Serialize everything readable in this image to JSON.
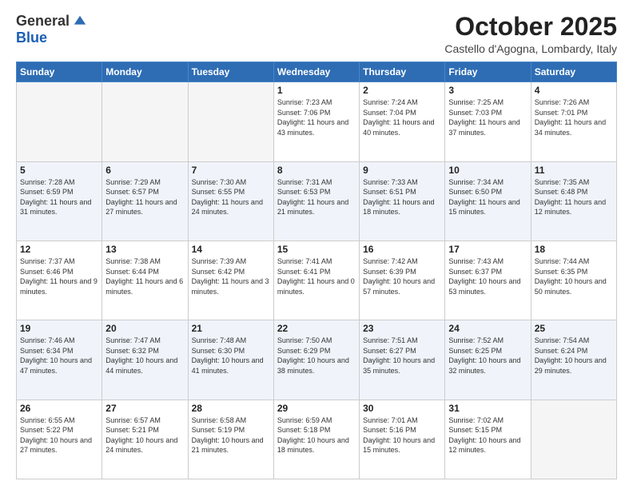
{
  "logo": {
    "general": "General",
    "blue": "Blue"
  },
  "header": {
    "month": "October 2025",
    "location": "Castello d'Agogna, Lombardy, Italy"
  },
  "days": [
    "Sunday",
    "Monday",
    "Tuesday",
    "Wednesday",
    "Thursday",
    "Friday",
    "Saturday"
  ],
  "weeks": [
    [
      {
        "day": "",
        "info": ""
      },
      {
        "day": "",
        "info": ""
      },
      {
        "day": "",
        "info": ""
      },
      {
        "day": "1",
        "info": "Sunrise: 7:23 AM\nSunset: 7:06 PM\nDaylight: 11 hours\nand 43 minutes."
      },
      {
        "day": "2",
        "info": "Sunrise: 7:24 AM\nSunset: 7:04 PM\nDaylight: 11 hours\nand 40 minutes."
      },
      {
        "day": "3",
        "info": "Sunrise: 7:25 AM\nSunset: 7:03 PM\nDaylight: 11 hours\nand 37 minutes."
      },
      {
        "day": "4",
        "info": "Sunrise: 7:26 AM\nSunset: 7:01 PM\nDaylight: 11 hours\nand 34 minutes."
      }
    ],
    [
      {
        "day": "5",
        "info": "Sunrise: 7:28 AM\nSunset: 6:59 PM\nDaylight: 11 hours\nand 31 minutes."
      },
      {
        "day": "6",
        "info": "Sunrise: 7:29 AM\nSunset: 6:57 PM\nDaylight: 11 hours\nand 27 minutes."
      },
      {
        "day": "7",
        "info": "Sunrise: 7:30 AM\nSunset: 6:55 PM\nDaylight: 11 hours\nand 24 minutes."
      },
      {
        "day": "8",
        "info": "Sunrise: 7:31 AM\nSunset: 6:53 PM\nDaylight: 11 hours\nand 21 minutes."
      },
      {
        "day": "9",
        "info": "Sunrise: 7:33 AM\nSunset: 6:51 PM\nDaylight: 11 hours\nand 18 minutes."
      },
      {
        "day": "10",
        "info": "Sunrise: 7:34 AM\nSunset: 6:50 PM\nDaylight: 11 hours\nand 15 minutes."
      },
      {
        "day": "11",
        "info": "Sunrise: 7:35 AM\nSunset: 6:48 PM\nDaylight: 11 hours\nand 12 minutes."
      }
    ],
    [
      {
        "day": "12",
        "info": "Sunrise: 7:37 AM\nSunset: 6:46 PM\nDaylight: 11 hours\nand 9 minutes."
      },
      {
        "day": "13",
        "info": "Sunrise: 7:38 AM\nSunset: 6:44 PM\nDaylight: 11 hours\nand 6 minutes."
      },
      {
        "day": "14",
        "info": "Sunrise: 7:39 AM\nSunset: 6:42 PM\nDaylight: 11 hours\nand 3 minutes."
      },
      {
        "day": "15",
        "info": "Sunrise: 7:41 AM\nSunset: 6:41 PM\nDaylight: 11 hours\nand 0 minutes."
      },
      {
        "day": "16",
        "info": "Sunrise: 7:42 AM\nSunset: 6:39 PM\nDaylight: 10 hours\nand 57 minutes."
      },
      {
        "day": "17",
        "info": "Sunrise: 7:43 AM\nSunset: 6:37 PM\nDaylight: 10 hours\nand 53 minutes."
      },
      {
        "day": "18",
        "info": "Sunrise: 7:44 AM\nSunset: 6:35 PM\nDaylight: 10 hours\nand 50 minutes."
      }
    ],
    [
      {
        "day": "19",
        "info": "Sunrise: 7:46 AM\nSunset: 6:34 PM\nDaylight: 10 hours\nand 47 minutes."
      },
      {
        "day": "20",
        "info": "Sunrise: 7:47 AM\nSunset: 6:32 PM\nDaylight: 10 hours\nand 44 minutes."
      },
      {
        "day": "21",
        "info": "Sunrise: 7:48 AM\nSunset: 6:30 PM\nDaylight: 10 hours\nand 41 minutes."
      },
      {
        "day": "22",
        "info": "Sunrise: 7:50 AM\nSunset: 6:29 PM\nDaylight: 10 hours\nand 38 minutes."
      },
      {
        "day": "23",
        "info": "Sunrise: 7:51 AM\nSunset: 6:27 PM\nDaylight: 10 hours\nand 35 minutes."
      },
      {
        "day": "24",
        "info": "Sunrise: 7:52 AM\nSunset: 6:25 PM\nDaylight: 10 hours\nand 32 minutes."
      },
      {
        "day": "25",
        "info": "Sunrise: 7:54 AM\nSunset: 6:24 PM\nDaylight: 10 hours\nand 29 minutes."
      }
    ],
    [
      {
        "day": "26",
        "info": "Sunrise: 6:55 AM\nSunset: 5:22 PM\nDaylight: 10 hours\nand 27 minutes."
      },
      {
        "day": "27",
        "info": "Sunrise: 6:57 AM\nSunset: 5:21 PM\nDaylight: 10 hours\nand 24 minutes."
      },
      {
        "day": "28",
        "info": "Sunrise: 6:58 AM\nSunset: 5:19 PM\nDaylight: 10 hours\nand 21 minutes."
      },
      {
        "day": "29",
        "info": "Sunrise: 6:59 AM\nSunset: 5:18 PM\nDaylight: 10 hours\nand 18 minutes."
      },
      {
        "day": "30",
        "info": "Sunrise: 7:01 AM\nSunset: 5:16 PM\nDaylight: 10 hours\nand 15 minutes."
      },
      {
        "day": "31",
        "info": "Sunrise: 7:02 AM\nSunset: 5:15 PM\nDaylight: 10 hours\nand 12 minutes."
      },
      {
        "day": "",
        "info": ""
      }
    ]
  ]
}
